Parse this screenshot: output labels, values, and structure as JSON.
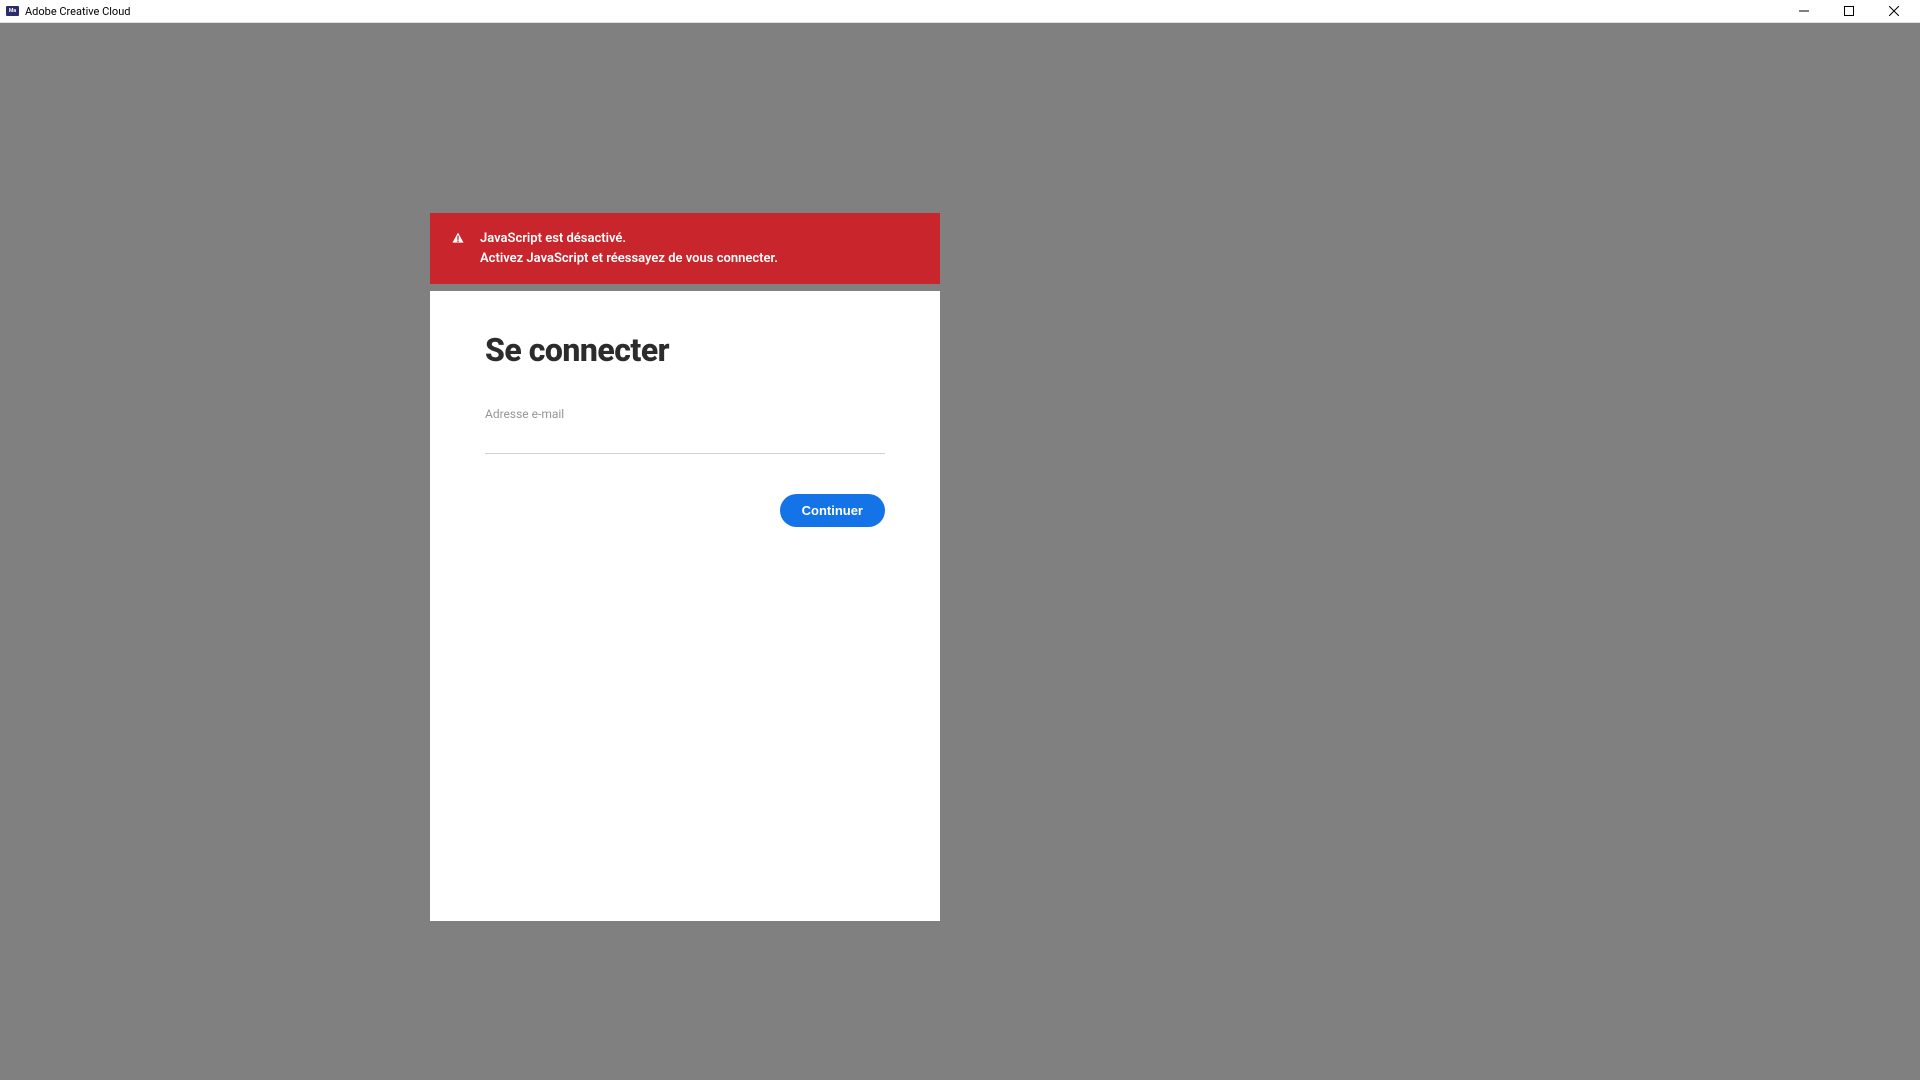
{
  "window": {
    "title": "Adobe Creative Cloud",
    "icon_text": "Ma"
  },
  "alert": {
    "line1": "JavaScript est désactivé.",
    "line2": "Activez JavaScript et réessayez de vous connecter."
  },
  "signin": {
    "title": "Se connecter",
    "email_label": "Adresse e-mail",
    "email_value": "",
    "continue_label": "Continuer"
  }
}
